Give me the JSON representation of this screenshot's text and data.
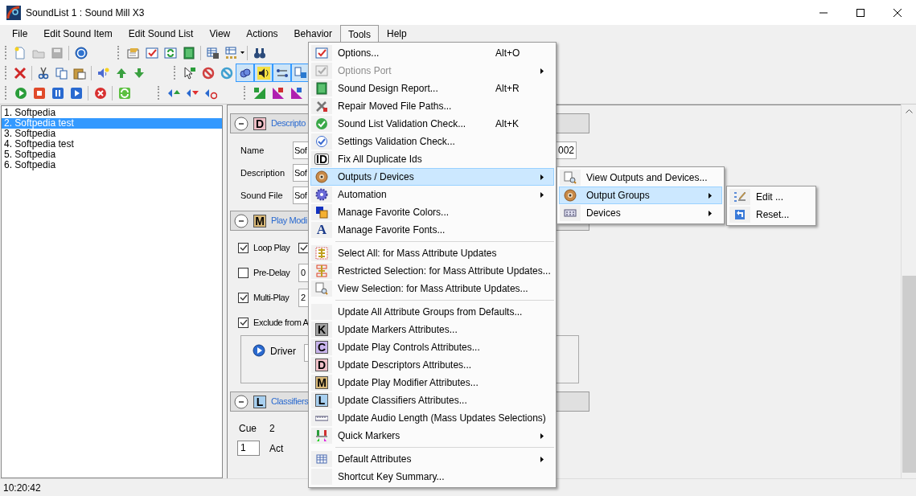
{
  "window": {
    "title": "SoundList 1 : Sound Mill X3"
  },
  "menubar": [
    {
      "label": "File",
      "selected": false
    },
    {
      "label": "Edit Sound Item",
      "selected": false
    },
    {
      "label": "Edit Sound List",
      "selected": false
    },
    {
      "label": "View",
      "selected": false
    },
    {
      "label": "Actions",
      "selected": false
    },
    {
      "label": "Behavior",
      "selected": false
    },
    {
      "label": "Tools",
      "selected": true
    },
    {
      "label": "Help",
      "selected": false
    }
  ],
  "sound_list": [
    {
      "label": "1. Softpedia",
      "selected": false
    },
    {
      "label": "2. Softpedia test",
      "selected": true
    },
    {
      "label": "3. Softpedia",
      "selected": false
    },
    {
      "label": "4. Softpedia test",
      "selected": false
    },
    {
      "label": "5. Softpedia",
      "selected": false
    },
    {
      "label": "6. Softpedia",
      "selected": false
    }
  ],
  "descriptors": {
    "badge": "D",
    "title": "Descripto",
    "fields": [
      {
        "label": "Name",
        "value": "Sof"
      },
      {
        "label": "Description",
        "value": "Sof"
      },
      {
        "label": "Sound File",
        "value": "Sof"
      }
    ],
    "id_value": "002"
  },
  "play_modifier": {
    "badge": "M",
    "title": "Play Modi",
    "options": [
      {
        "label": "Loop Play",
        "checked": true,
        "second_checked": true
      },
      {
        "label": "Pre-Delay",
        "checked": false,
        "value": "0"
      },
      {
        "label": "Multi-Play",
        "checked": true,
        "value": "2"
      },
      {
        "label": "Exclude from A",
        "checked": true
      }
    ],
    "driver_label": "Driver"
  },
  "classifiers": {
    "badge": "L",
    "title": "Classifiers",
    "cue_label": "Cue",
    "cue_value": "2",
    "act_value": "1",
    "act_label": "Act"
  },
  "tools_menu": [
    {
      "kind": "item",
      "label": "Options...",
      "shortcut": "Alt+O",
      "has_submenu": false,
      "disabled": false,
      "selected": false
    },
    {
      "kind": "item",
      "label": "Options Port",
      "has_submenu": true,
      "disabled": true,
      "selected": false
    },
    {
      "kind": "item",
      "label": "Sound Design Report...",
      "shortcut": "Alt+R",
      "has_submenu": false,
      "disabled": false,
      "selected": false
    },
    {
      "kind": "item",
      "label": "Repair Moved File Paths...",
      "has_submenu": false,
      "disabled": false,
      "selected": false
    },
    {
      "kind": "item",
      "label": "Sound List Validation Check...",
      "shortcut": "Alt+K",
      "has_submenu": false,
      "disabled": false,
      "selected": false
    },
    {
      "kind": "item",
      "label": "Settings Validation Check...",
      "has_submenu": false,
      "disabled": false,
      "selected": false
    },
    {
      "kind": "item",
      "label": "Fix All Duplicate Ids",
      "badge": "ID",
      "has_submenu": false,
      "disabled": false,
      "selected": false
    },
    {
      "kind": "item",
      "label": "Outputs / Devices",
      "has_submenu": true,
      "disabled": false,
      "selected": true
    },
    {
      "kind": "item",
      "label": "Automation",
      "has_submenu": true,
      "disabled": false,
      "selected": false
    },
    {
      "kind": "item",
      "label": "Manage Favorite Colors...",
      "has_submenu": false,
      "disabled": false,
      "selected": false
    },
    {
      "kind": "item",
      "label": "Manage Favorite Fonts...",
      "badge": "A",
      "has_submenu": false,
      "disabled": false,
      "selected": false
    },
    {
      "kind": "separator"
    },
    {
      "kind": "item",
      "label": "Select All: for Mass Attribute Updates",
      "has_submenu": false,
      "disabled": false,
      "selected": false
    },
    {
      "kind": "item",
      "label": "Restricted Selection: for Mass Attribute Updates...",
      "has_submenu": false,
      "disabled": false,
      "selected": false
    },
    {
      "kind": "item",
      "label": "View Selection: for Mass Attribute Updates...",
      "has_submenu": false,
      "disabled": false,
      "selected": false
    },
    {
      "kind": "separator"
    },
    {
      "kind": "item",
      "label": "Update All Attribute Groups from Defaults...",
      "has_submenu": false,
      "disabled": false,
      "selected": false
    },
    {
      "kind": "item",
      "label": "Update Markers Attributes...",
      "badge": "K",
      "has_submenu": false,
      "disabled": false,
      "selected": false
    },
    {
      "kind": "item",
      "label": "Update Play Controls Attributes...",
      "badge": "C",
      "has_submenu": false,
      "disabled": false,
      "selected": false
    },
    {
      "kind": "item",
      "label": "Update Descriptors Attributes...",
      "badge": "D",
      "has_submenu": false,
      "disabled": false,
      "selected": false
    },
    {
      "kind": "item",
      "label": "Update Play Modifier Attributes...",
      "badge": "M",
      "has_submenu": false,
      "disabled": false,
      "selected": false
    },
    {
      "kind": "item",
      "label": "Update Classifiers Attributes...",
      "badge": "L",
      "has_submenu": false,
      "disabled": false,
      "selected": false
    },
    {
      "kind": "item",
      "label": "Update Audio Length (Mass Updates Selections)",
      "has_submenu": false,
      "disabled": false,
      "selected": false
    },
    {
      "kind": "item",
      "label": "Quick Markers",
      "has_submenu": true,
      "disabled": false,
      "selected": false
    },
    {
      "kind": "separator"
    },
    {
      "kind": "item",
      "label": "Default Attributes",
      "has_submenu": true,
      "disabled": false,
      "selected": false
    },
    {
      "kind": "item",
      "label": "Shortcut Key Summary...",
      "has_submenu": false,
      "disabled": false,
      "selected": false
    }
  ],
  "outputs_submenu": [
    {
      "label": "View Outputs and Devices...",
      "has_submenu": false,
      "selected": false
    },
    {
      "label": "Output Groups",
      "has_submenu": true,
      "selected": true
    },
    {
      "label": "Devices",
      "has_submenu": true,
      "selected": false
    }
  ],
  "output_groups_submenu": [
    {
      "label": "Edit ...",
      "selected": false
    },
    {
      "label": "Reset...",
      "selected": false
    }
  ],
  "status_bar": {
    "time": "10:20:42"
  }
}
